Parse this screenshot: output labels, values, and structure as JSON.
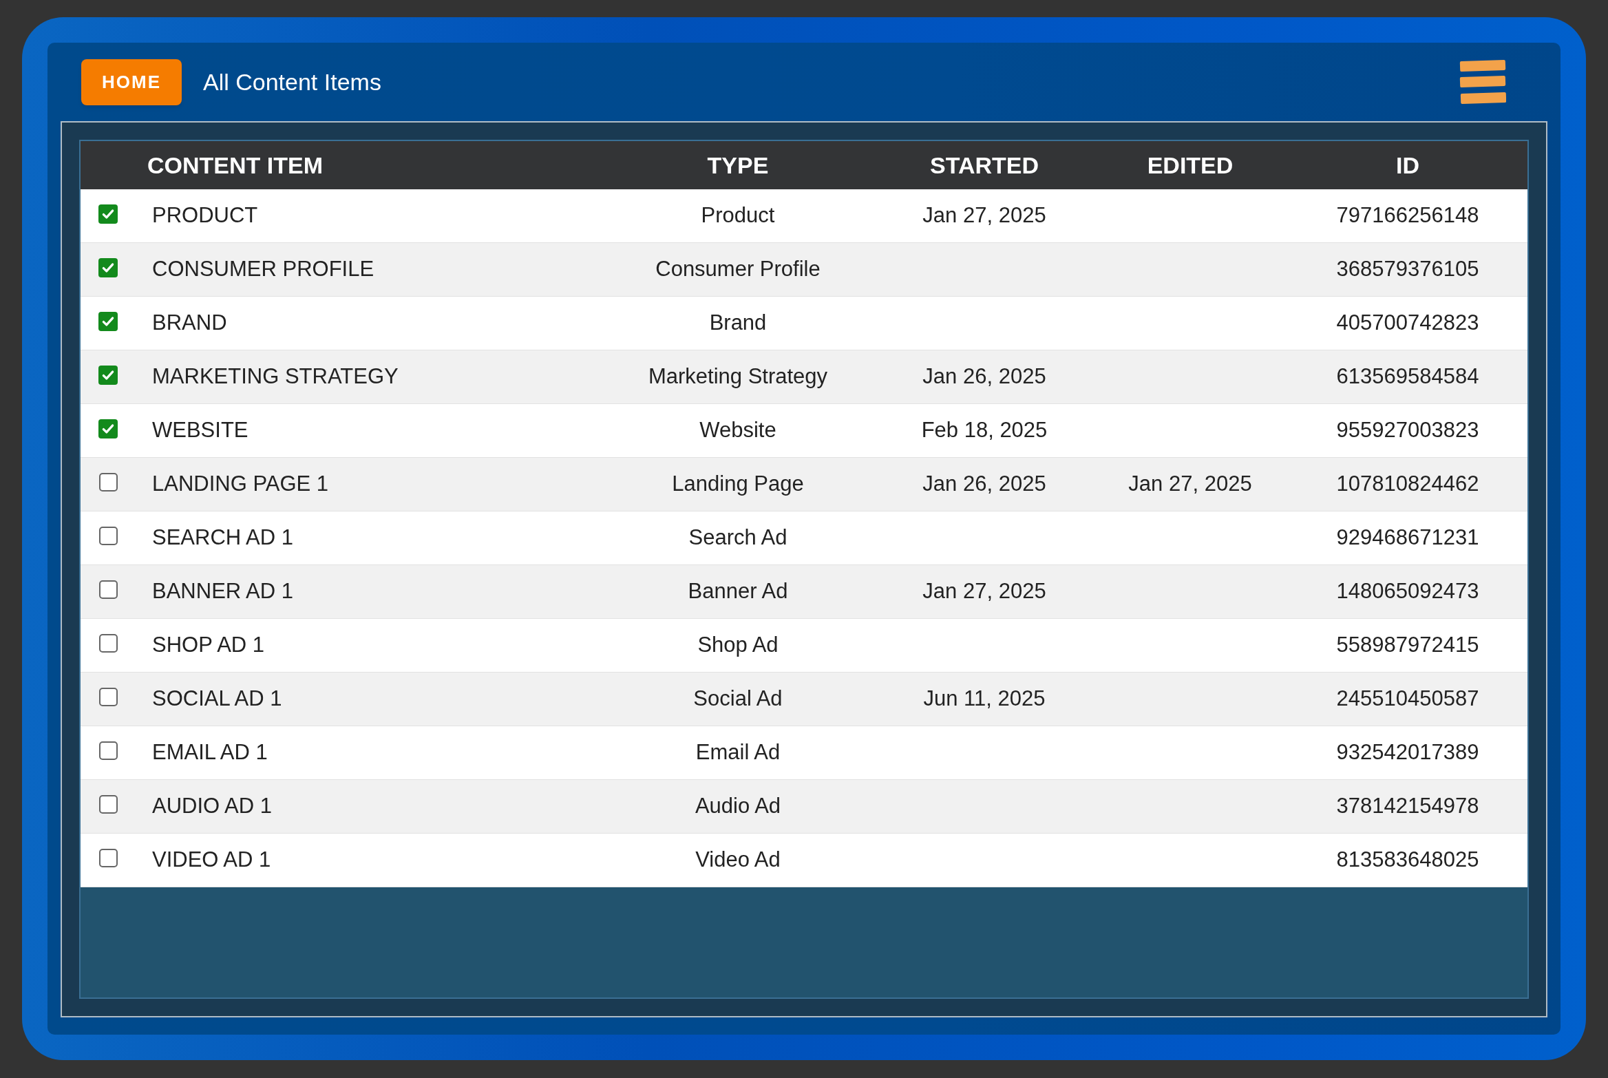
{
  "header": {
    "home_button": "HOME",
    "title": "All Content Items"
  },
  "table": {
    "columns": [
      "CONTENT ITEM",
      "TYPE",
      "STARTED",
      "EDITED",
      "ID"
    ],
    "rows": [
      {
        "checked": true,
        "content_item": "PRODUCT",
        "type": "Product",
        "started": "Jan 27, 2025",
        "id": "797166256148"
      },
      {
        "checked": true,
        "content_item": "CONSUMER PROFILE",
        "type": "Consumer Profile",
        "id": "368579376105"
      },
      {
        "checked": true,
        "content_item": "BRAND",
        "type": "Brand",
        "id": "405700742823"
      },
      {
        "checked": true,
        "content_item": "MARKETING STRATEGY",
        "type": "Marketing Strategy",
        "started": "Jan 26, 2025",
        "id": "613569584584"
      },
      {
        "checked": true,
        "content_item": "WEBSITE",
        "type": "Website",
        "started": "Feb 18, 2025",
        "id": "955927003823"
      },
      {
        "checked": false,
        "content_item": "LANDING PAGE 1",
        "type": "Landing Page",
        "started": "Jan 26, 2025",
        "edited": "Jan 27, 2025",
        "id": "107810824462"
      },
      {
        "checked": false,
        "content_item": "SEARCH AD 1",
        "type": "Search Ad",
        "id": "929468671231"
      },
      {
        "checked": false,
        "content_item": "BANNER AD 1",
        "type": "Banner Ad",
        "started": "Jan 27, 2025",
        "id": "148065092473"
      },
      {
        "checked": false,
        "content_item": "SHOP AD 1",
        "type": "Shop Ad",
        "id": "558987972415"
      },
      {
        "checked": false,
        "content_item": "SOCIAL AD 1",
        "type": "Social Ad",
        "started": "Jun 11, 2025",
        "id": "245510450587"
      },
      {
        "checked": false,
        "content_item": "EMAIL AD 1",
        "type": "Email Ad",
        "id": "932542017389"
      },
      {
        "checked": false,
        "content_item": "AUDIO AD 1",
        "type": "Audio Ad",
        "id": "378142154978"
      },
      {
        "checked": false,
        "content_item": "VIDEO AD 1",
        "type": "Video Ad",
        "id": "813583648025"
      }
    ]
  }
}
